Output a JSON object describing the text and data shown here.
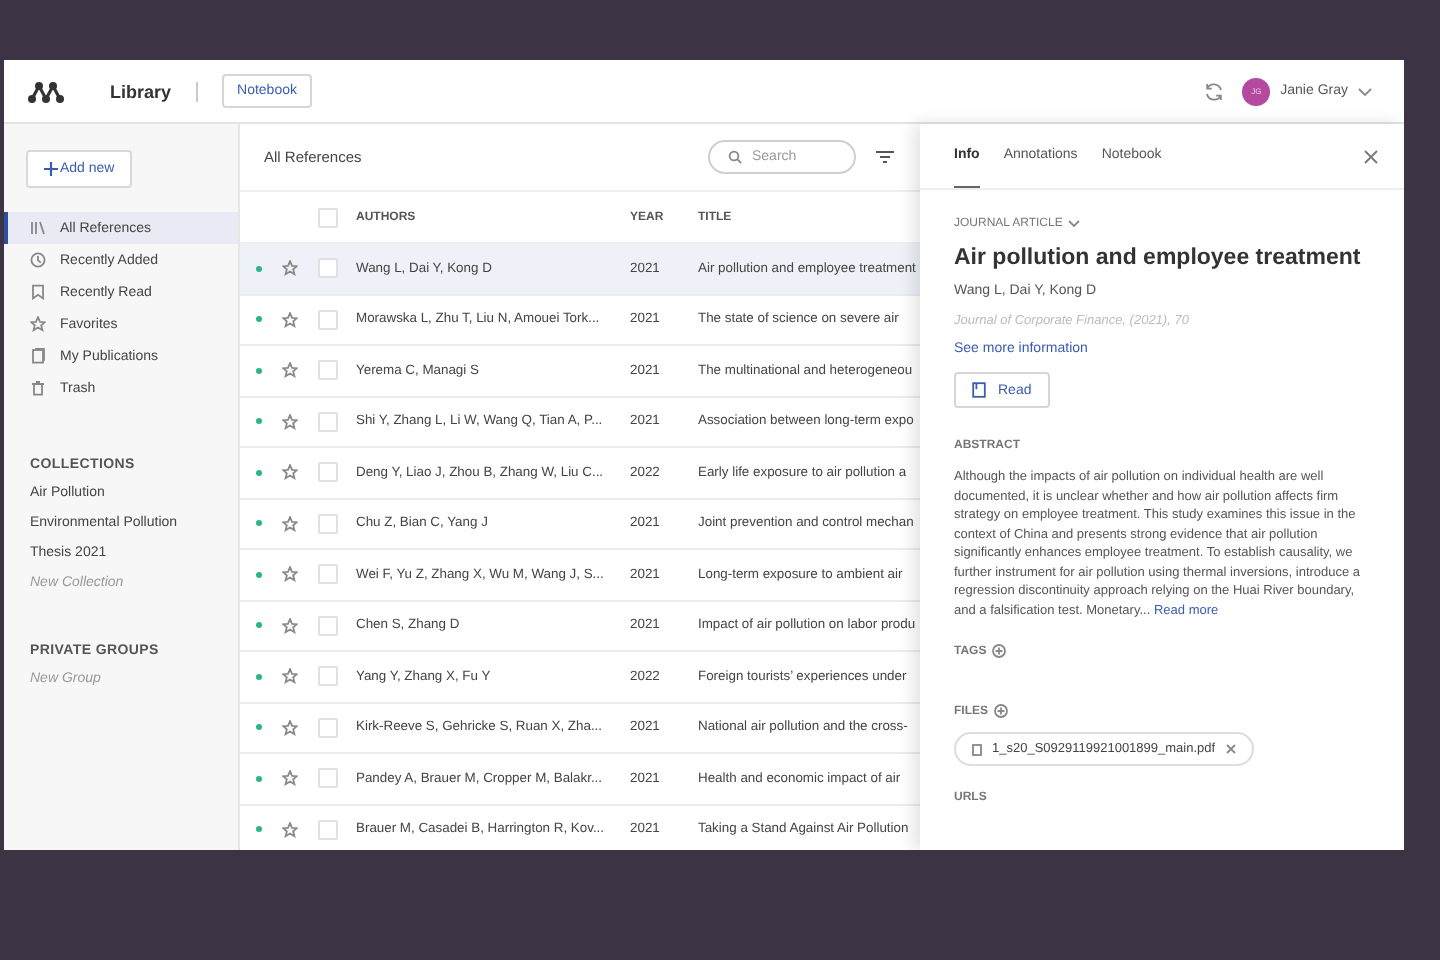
{
  "topbar": {
    "app_title": "Library",
    "notebook_button": "Notebook",
    "user": {
      "initials": "JG",
      "name": "Janie Gray"
    }
  },
  "sidebar": {
    "add_button": "Add new",
    "nav": [
      {
        "label": "All References",
        "selected": true
      },
      {
        "label": "Recently Added",
        "selected": false
      },
      {
        "label": "Recently Read",
        "selected": false
      },
      {
        "label": "Favorites",
        "selected": false
      },
      {
        "label": "My Publications",
        "selected": false
      },
      {
        "label": "Trash",
        "selected": false
      }
    ],
    "collections": {
      "heading": "COLLECTIONS",
      "items": [
        "Air Pollution",
        "Environmental Pollution",
        "Thesis 2021"
      ],
      "new_item": "New Collection"
    },
    "groups": {
      "heading": "PRIVATE GROUPS",
      "new_item": "New Group"
    }
  },
  "list": {
    "title": "All References",
    "search": {
      "placeholder": "Search"
    },
    "columns": [
      "AUTHORS",
      "YEAR",
      "TITLE"
    ],
    "select_all_checked": false,
    "rows": [
      {
        "authors": "Wang L, Dai Y, Kong D",
        "year": "2021",
        "title": "Air pollution and employee treatment",
        "unread": true,
        "favorite": false,
        "checked": false,
        "selected": true
      },
      {
        "authors": "Morawska L, Zhu T, Liu N, Amouei Tork...",
        "year": "2021",
        "title": "The state of science on severe air",
        "unread": true,
        "favorite": false,
        "checked": false,
        "selected": false
      },
      {
        "authors": "Yerema C, Managi S",
        "year": "2021",
        "title": "The multinational and heterogeneou",
        "unread": true,
        "favorite": false,
        "checked": false,
        "selected": false
      },
      {
        "authors": "Shi Y, Zhang L, Li W, Wang Q, Tian A, P...",
        "year": "2021",
        "title": "Association between long-term expo",
        "unread": true,
        "favorite": false,
        "checked": false,
        "selected": false
      },
      {
        "authors": "Deng Y, Liao J, Zhou B, Zhang W, Liu C...",
        "year": "2022",
        "title": "Early life exposure to air pollution a",
        "unread": true,
        "favorite": false,
        "checked": false,
        "selected": false
      },
      {
        "authors": "Chu Z, Bian C, Yang J",
        "year": "2021",
        "title": "Joint prevention and control mechan",
        "unread": true,
        "favorite": false,
        "checked": false,
        "selected": false
      },
      {
        "authors": "Wei F, Yu Z, Zhang X, Wu M, Wang J, S...",
        "year": "2021",
        "title": "Long-term exposure to ambient air",
        "unread": true,
        "favorite": false,
        "checked": false,
        "selected": false
      },
      {
        "authors": "Chen S, Zhang D",
        "year": "2021",
        "title": "Impact of air pollution on labor produ",
        "unread": true,
        "favorite": false,
        "checked": false,
        "selected": false
      },
      {
        "authors": "Yang Y, Zhang X, Fu Y",
        "year": "2022",
        "title": "Foreign tourists’ experiences under",
        "unread": true,
        "favorite": false,
        "checked": false,
        "selected": false
      },
      {
        "authors": "Kirk-Reeve S, Gehricke S, Ruan X, Zha...",
        "year": "2021",
        "title": "National air pollution and the cross-",
        "unread": true,
        "favorite": false,
        "checked": false,
        "selected": false
      },
      {
        "authors": "Pandey A, Brauer M, Cropper M, Balakr...",
        "year": "2021",
        "title": "Health and economic impact of air",
        "unread": true,
        "favorite": false,
        "checked": false,
        "selected": false
      },
      {
        "authors": "Brauer M, Casadei B, Harrington R, Kov...",
        "year": "2021",
        "title": "Taking a Stand Against Air Pollution",
        "unread": true,
        "favorite": false,
        "checked": false,
        "selected": false
      }
    ]
  },
  "details": {
    "tabs": [
      {
        "label": "Info",
        "selected": true
      },
      {
        "label": "Annotations",
        "selected": false
      },
      {
        "label": "Notebook",
        "selected": false
      }
    ],
    "type": "JOURNAL ARTICLE",
    "title": "Air pollution and employee treatment",
    "authors": "Wang L, Dai Y, Kong D",
    "source": "Journal of Corporate Finance, (2021), 70",
    "more_link": "See more information",
    "read_button": "Read",
    "abstract": {
      "heading": "ABSTRACT",
      "text": "Although the impacts of air pollution on individual health are well documented, it is unclear whether and how air pollution affects firm strategy on employee treatment. This study examines this issue in the context of China and presents strong evidence that air pollution significantly enhances employee treatment. To establish causality, we further instrument for air pollution using thermal inversions, introduce a regression discontinuity approach relying on the Huai River boundary, and a falsification test. Monetary...",
      "more_link": "Read more"
    },
    "tags": {
      "heading": "TAGS"
    },
    "files": {
      "heading": "FILES",
      "items": [
        {
          "name": "1_s20_S0929119921001899_main.pdf"
        }
      ]
    },
    "urls": {
      "heading": "URLS"
    }
  }
}
